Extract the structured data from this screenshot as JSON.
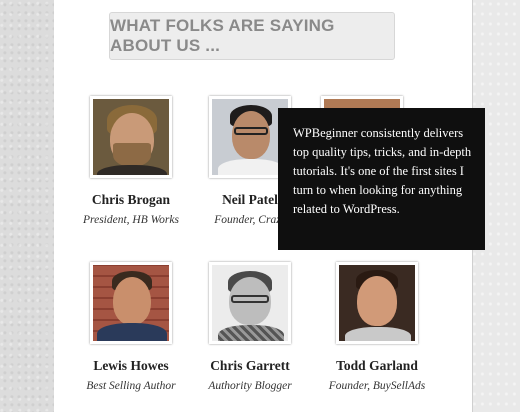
{
  "section": {
    "heading": "WHAT FOLKS ARE SAYING ABOUT US ..."
  },
  "testimonials": [
    {
      "name": "Chris Brogan",
      "role": "President, HB Works"
    },
    {
      "name": "Neil Patel",
      "role": "Founder, Crazy"
    },
    {
      "name": "",
      "role": ""
    },
    {
      "name": "Lewis Howes",
      "role": "Best Selling Author"
    },
    {
      "name": "Chris Garrett",
      "role": "Authority Blogger"
    },
    {
      "name": "Todd Garland",
      "role": "Founder, BuySellAds"
    }
  ],
  "tooltip": {
    "text": "WPBeginner consistently delivers top quality tips, tricks, and in-depth tutorials. It's one of the first sites I turn to when looking for anything related to WordPress."
  },
  "colors": {
    "tooltip_bg": "#0f0f0f",
    "heading_bg": "#ededed",
    "heading_text": "#8a8a8a"
  }
}
